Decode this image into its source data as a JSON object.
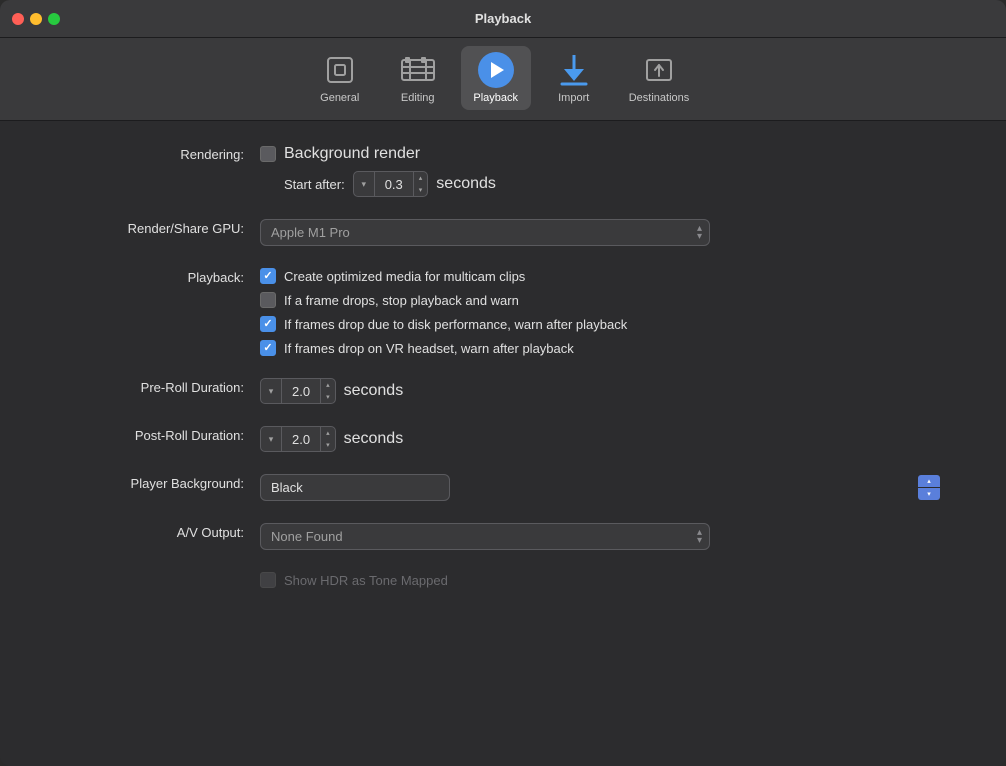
{
  "window": {
    "title": "Playback"
  },
  "toolbar": {
    "items": [
      {
        "id": "general",
        "label": "General",
        "active": false
      },
      {
        "id": "editing",
        "label": "Editing",
        "active": false
      },
      {
        "id": "playback",
        "label": "Playback",
        "active": true
      },
      {
        "id": "import",
        "label": "Import",
        "active": false
      },
      {
        "id": "destinations",
        "label": "Destinations",
        "active": false
      }
    ]
  },
  "form": {
    "rendering_label": "Rendering:",
    "background_render_label": "Background render",
    "start_after_label": "Start after:",
    "start_after_value": "0.3",
    "seconds_label": "seconds",
    "render_gpu_label": "Render/Share GPU:",
    "render_gpu_value": "Apple M1 Pro",
    "playback_label": "Playback:",
    "playback_options": [
      {
        "id": "multicam",
        "label": "Create optimized media for multicam clips",
        "checked": true
      },
      {
        "id": "framedrop",
        "label": "If a frame drops, stop playback and warn",
        "checked": false
      },
      {
        "id": "diskperf",
        "label": "If frames drop due to disk performance, warn after playback",
        "checked": true
      },
      {
        "id": "vrheadset",
        "label": "If frames drop on VR headset, warn after playback",
        "checked": true
      }
    ],
    "preroll_label": "Pre-Roll Duration:",
    "preroll_value": "2.0",
    "postroll_label": "Post-Roll Duration:",
    "postroll_value": "2.0",
    "player_bg_label": "Player Background:",
    "player_bg_value": "Black",
    "av_output_label": "A/V Output:",
    "av_output_value": "None Found",
    "show_hdr_label": "Show HDR as Tone Mapped"
  }
}
